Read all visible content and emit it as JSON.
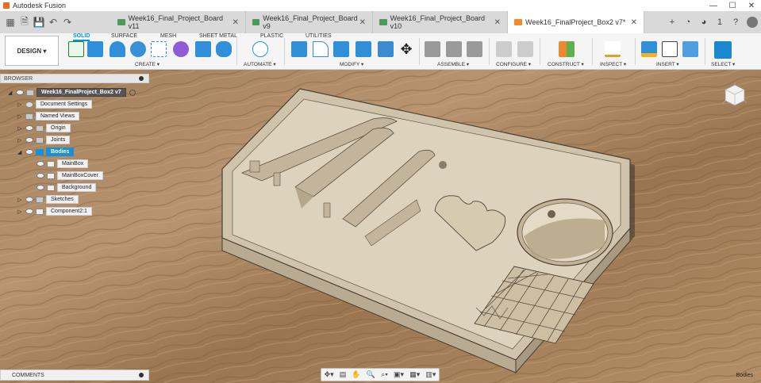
{
  "window": {
    "title": "Autodesk Fusion"
  },
  "tabs": [
    {
      "label": "Week16_Final_Project_Board v11",
      "active": false
    },
    {
      "label": "Week16_Final_Project_Board v9",
      "active": false
    },
    {
      "label": "Week16_Final_Project_Board v10",
      "active": false
    },
    {
      "label": "Week16_FinalProject_Box2 v7*",
      "active": true
    }
  ],
  "toolbar": {
    "workspace": "DESIGN ▾",
    "subtabs": [
      "SOLID",
      "SURFACE",
      "MESH",
      "SHEET METAL",
      "PLASTIC",
      "UTILITIES"
    ],
    "groups": [
      "CREATE ▾",
      "AUTOMATE ▾",
      "MODIFY ▾",
      "ASSEMBLE ▾",
      "CONFIGURE ▾",
      "CONSTRUCT ▾",
      "INSPECT ▾",
      "INSERT ▾",
      "SELECT ▾"
    ]
  },
  "header_right": {
    "notifications": "1"
  },
  "browser": {
    "title": "BROWSER",
    "items": [
      {
        "label": "Week16_FinalProject_Box2 v7"
      },
      {
        "label": "Document Settings"
      },
      {
        "label": "Named Views"
      },
      {
        "label": "Origin"
      },
      {
        "label": "Joints"
      },
      {
        "label": "Bodies"
      },
      {
        "label": "MainBox"
      },
      {
        "label": "MainBoxCover"
      },
      {
        "label": "Background"
      },
      {
        "label": "Sketches"
      },
      {
        "label": "Component2:1"
      }
    ]
  },
  "comments": {
    "title": "COMMENTS"
  },
  "status": {
    "selection": "Bodies"
  },
  "colors": {
    "accent": "#0696d7",
    "wood": "#b08a60",
    "model": "#d6cbb6"
  }
}
